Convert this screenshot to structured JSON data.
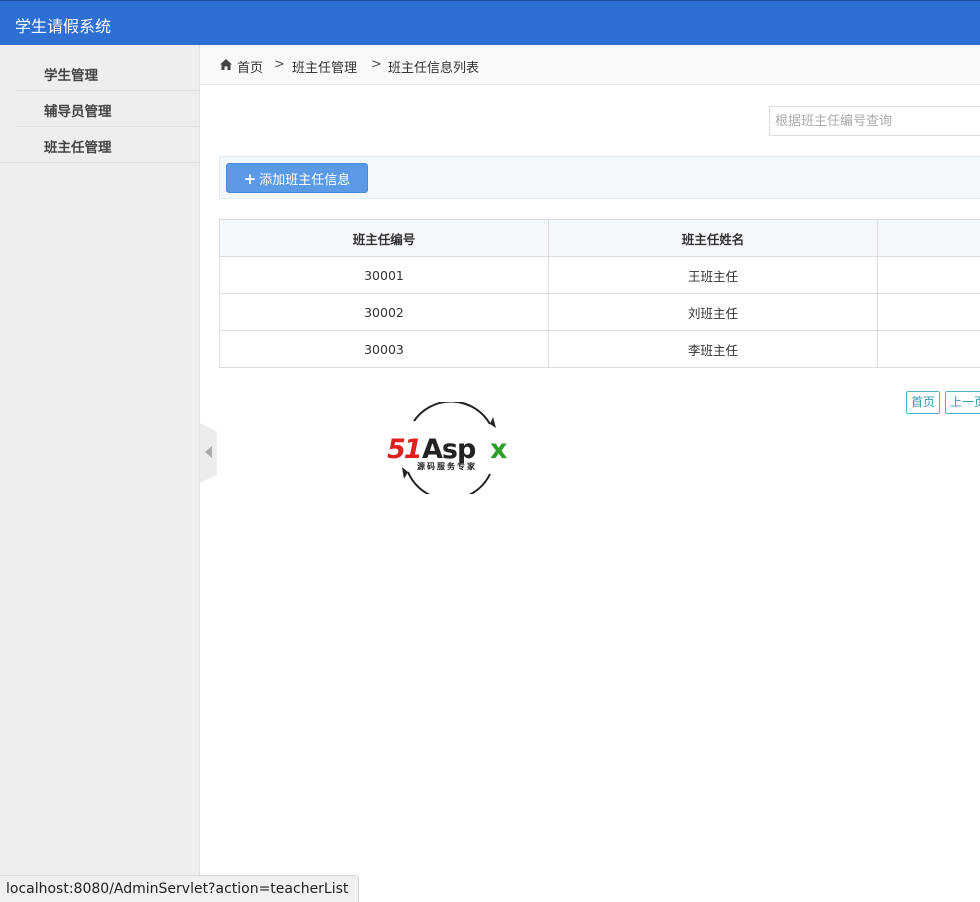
{
  "header": {
    "app_title": "学生请假系统"
  },
  "sidebar": {
    "items": [
      {
        "label": "学生管理"
      },
      {
        "label": "辅导员管理"
      },
      {
        "label": "班主任管理"
      }
    ]
  },
  "breadcrumb": {
    "items": [
      "首页",
      "班主任管理",
      "班主任信息列表"
    ],
    "separator": ">"
  },
  "search": {
    "placeholder": "根据班主任编号查询",
    "value": ""
  },
  "toolbar": {
    "add_label": "添加班主任信息",
    "add_icon": "+"
  },
  "table": {
    "headers": [
      "班主任编号",
      "班主任姓名",
      ""
    ],
    "rows": [
      [
        "30001",
        "王班主任",
        ""
      ],
      [
        "30002",
        "刘班主任",
        ""
      ],
      [
        "30003",
        "李班主任",
        ""
      ]
    ]
  },
  "pagination": {
    "first_label": "首页",
    "prev_label": "上一页"
  },
  "logo": {
    "text_main": "51Aspx",
    "text_sub": "源码服务专家"
  },
  "status_bar": {
    "url": "localhost:8080/AdminServlet?action=teacherList"
  },
  "colors": {
    "header_bg": "#2d6fd3",
    "button_bg": "#5b9be6",
    "pager_border": "#4fb2c9",
    "logo_red": "#e02020",
    "logo_green": "#2aa02a"
  }
}
